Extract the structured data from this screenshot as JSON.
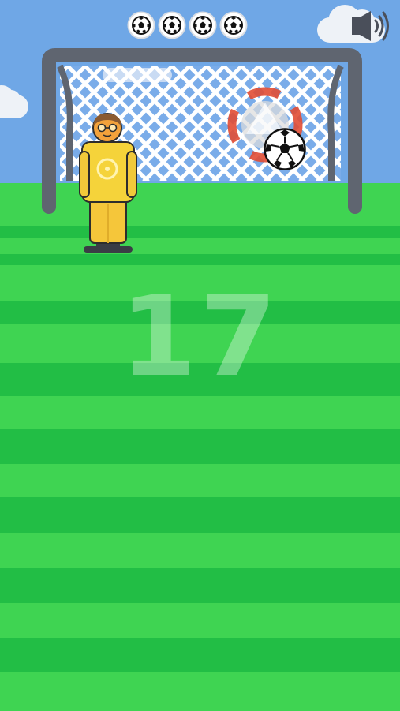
{
  "score": "17",
  "lives": {
    "count": 4,
    "icon": "soccer-ball-icon"
  },
  "sound": {
    "icon": "speaker-icon",
    "state": "on"
  },
  "colors": {
    "sky": "#6fa7e6",
    "grass_light": "#3fd452",
    "grass_dark": "#22be45",
    "goal_post": "#5e6470",
    "net": "#ffffff",
    "keeper_shirt": "#f5d33a",
    "target": "#e24d35"
  }
}
